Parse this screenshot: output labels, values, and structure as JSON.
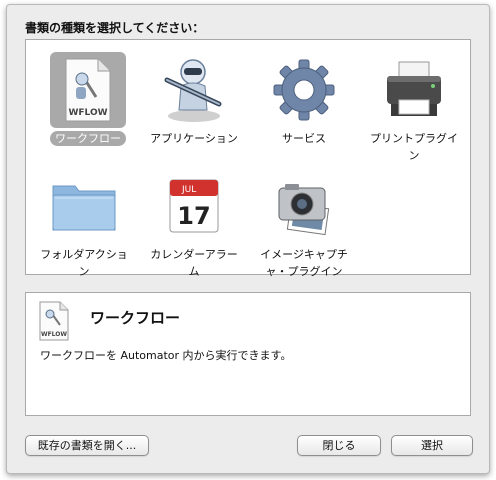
{
  "dialog": {
    "prompt": "書類の種類を選択してください："
  },
  "gallery": {
    "items": [
      {
        "label": "ワークフロー",
        "icon": "workflow-icon",
        "selected": true
      },
      {
        "label": "アプリケーション",
        "icon": "application-robot-icon",
        "selected": false
      },
      {
        "label": "サービス",
        "icon": "gear-icon",
        "selected": false
      },
      {
        "label": "プリントプラグイン",
        "icon": "printer-icon",
        "selected": false
      },
      {
        "label": "フォルダアクション",
        "icon": "folder-icon",
        "selected": false
      },
      {
        "label": "カレンダーアラーム",
        "icon": "calendar-icon",
        "selected": false
      },
      {
        "label": "イメージキャプチャ・プラグイン",
        "icon": "camera-icon",
        "selected": false
      }
    ],
    "calendar_month": "JUL",
    "calendar_day": "17",
    "workflow_badge": "WFLOW"
  },
  "detail": {
    "title": "ワークフロー",
    "description": "ワークフローを Automator 内から実行できます。",
    "icon": "workflow-icon",
    "badge": "WFLOW"
  },
  "buttons": {
    "open_existing": "既存の書類を開く...",
    "close": "閉じる",
    "choose": "選択"
  }
}
